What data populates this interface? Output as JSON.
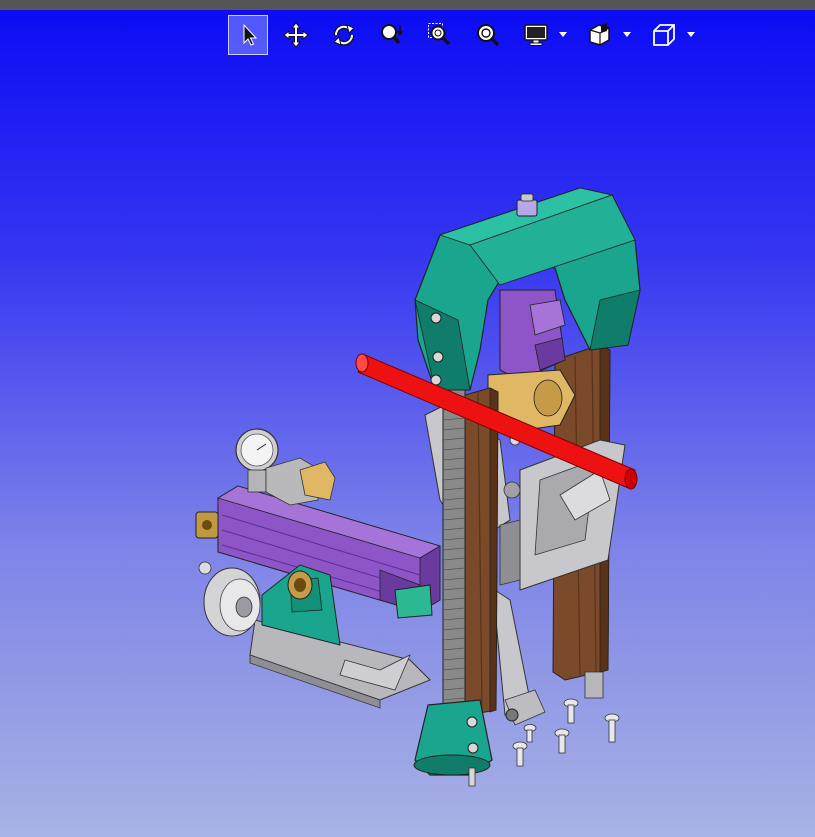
{
  "viewer": {
    "background_top": "#0a0af5",
    "background_bottom": "#a8b2e4",
    "topbar_color": "#555555"
  },
  "toolbar": {
    "buttons": [
      {
        "id": "select",
        "icon": "select-arrow-icon",
        "active": true
      },
      {
        "id": "pan",
        "icon": "pan-move-icon",
        "active": false
      },
      {
        "id": "rotate",
        "icon": "rotate-icon",
        "active": false
      },
      {
        "id": "zoom-dynamic",
        "icon": "zoom-dynamic-icon",
        "active": false
      },
      {
        "id": "zoom-window",
        "icon": "zoom-window-icon",
        "active": false
      },
      {
        "id": "zoom-fit",
        "icon": "zoom-fit-icon",
        "active": false
      },
      {
        "id": "display-mode",
        "icon": "display-monitor-icon",
        "active": false,
        "has_dropdown": true
      },
      {
        "id": "section",
        "icon": "section-cut-icon",
        "active": false,
        "has_dropdown": true
      },
      {
        "id": "view-orientation",
        "icon": "view-cube-icon",
        "active": false,
        "has_dropdown": true
      }
    ]
  },
  "model": {
    "colors": {
      "clamp": "#1aa58e",
      "clamp_dark": "#0f7d6a",
      "rail": "#7a4a2a",
      "leadscrew": "#8a8a8a",
      "purple": "#8e55c8",
      "purple_dark": "#6a3aa0",
      "tan": "#e0b865",
      "red_rod": "#ee1111",
      "steel": "#c8c8cc",
      "steel_dark": "#8e8e94"
    }
  }
}
